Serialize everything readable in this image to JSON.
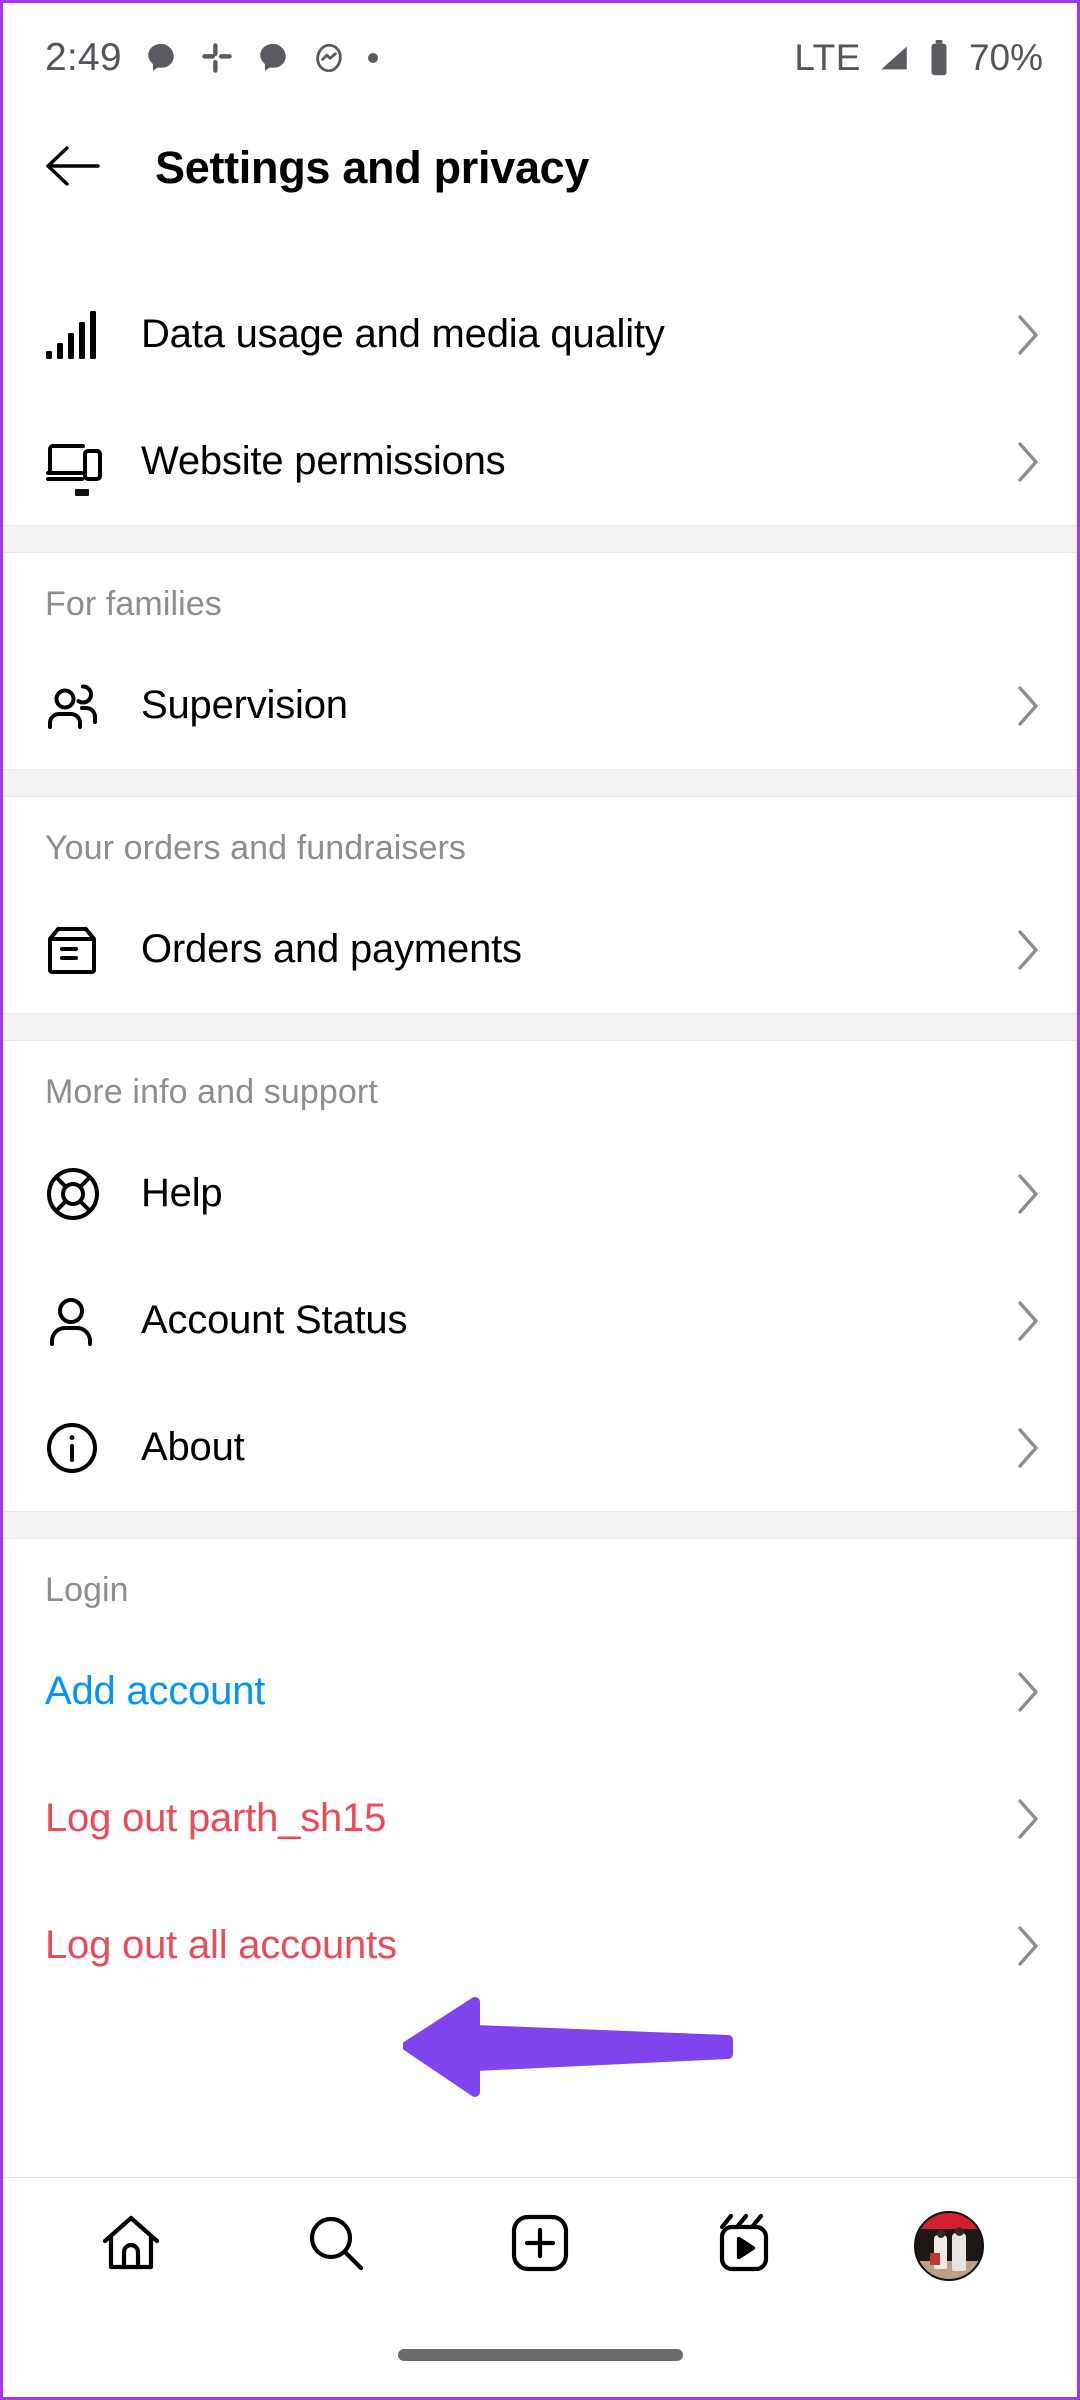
{
  "status_bar": {
    "time": "2:49",
    "left_icons": [
      "chat-bubble-icon",
      "slack-icon",
      "chat-bubble-icon",
      "activity-circle-icon",
      "dot-icon"
    ],
    "network_label": "LTE",
    "signal_icon": "signal-triangle-icon",
    "battery_icon": "battery-icon",
    "battery_percent": "70%"
  },
  "header": {
    "back_icon": "arrow-left-icon",
    "title": "Settings and privacy"
  },
  "sections": [
    {
      "title": "",
      "rows": [
        {
          "icon": "signal-bars-icon",
          "label": "Data usage and media quality",
          "style": "default"
        },
        {
          "icon": "devices-icon",
          "label": "Website permissions",
          "style": "default"
        }
      ]
    },
    {
      "title": "For families",
      "rows": [
        {
          "icon": "people-icon",
          "label": "Supervision",
          "style": "default"
        }
      ]
    },
    {
      "title": "Your orders and fundraisers",
      "rows": [
        {
          "icon": "box-icon",
          "label": "Orders and payments",
          "style": "default"
        }
      ]
    },
    {
      "title": "More info and support",
      "rows": [
        {
          "icon": "life-ring-icon",
          "label": "Help",
          "style": "default"
        },
        {
          "icon": "person-icon",
          "label": "Account Status",
          "style": "default"
        },
        {
          "icon": "info-circle-icon",
          "label": "About",
          "style": "default"
        }
      ]
    },
    {
      "title": "Login",
      "rows": [
        {
          "icon": "",
          "label": "Add account",
          "style": "blue"
        },
        {
          "icon": "",
          "label": "Log out parth_sh15",
          "style": "red"
        },
        {
          "icon": "",
          "label": "Log out all accounts",
          "style": "red"
        }
      ]
    }
  ],
  "annotation": {
    "target_label": "Log out parth_sh15",
    "arrow_color": "#7F44EE",
    "direction": "left"
  },
  "bottom_nav": [
    {
      "icon": "home-icon",
      "label": "Home"
    },
    {
      "icon": "search-icon",
      "label": "Search"
    },
    {
      "icon": "create-plus-icon",
      "label": "Create"
    },
    {
      "icon": "reels-icon",
      "label": "Reels"
    },
    {
      "icon": "profile-avatar",
      "label": "Profile"
    }
  ],
  "colors": {
    "accent_blue": "#0095F6",
    "danger_red": "#ED4956",
    "section_gray": "#F2F2F2",
    "muted_text": "#8E8E8E",
    "annotation_purple": "#7F44EE",
    "border_purple": "#A335F5"
  },
  "gesture_bar": "home-indicator"
}
